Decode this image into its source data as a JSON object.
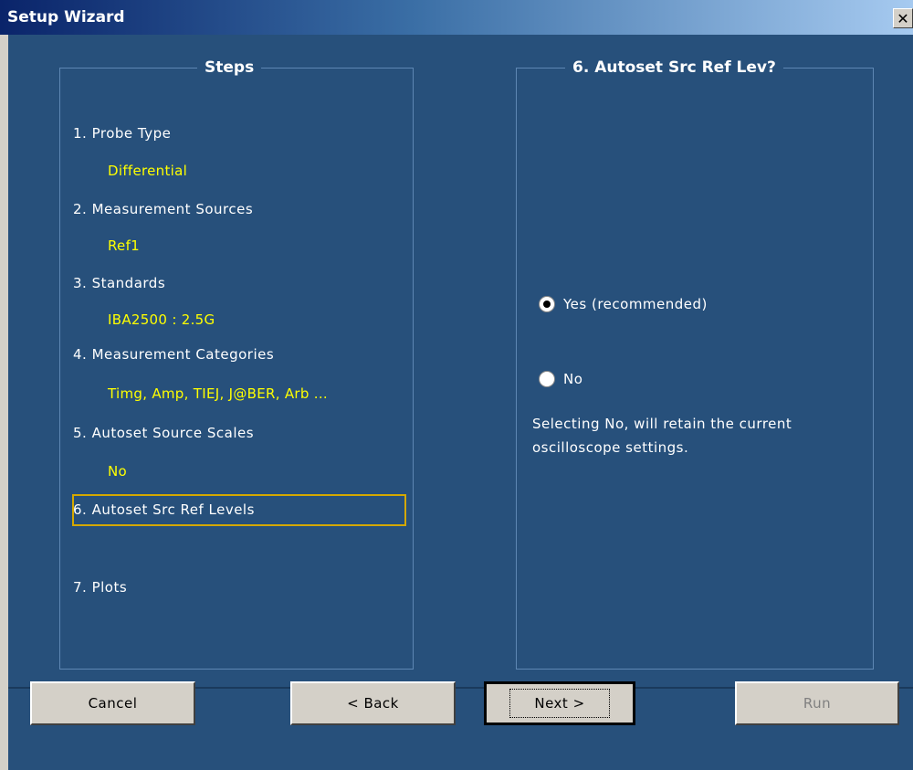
{
  "window": {
    "title": "Setup Wizard",
    "close_glyph": "✕"
  },
  "steps_panel": {
    "title": "Steps",
    "steps": [
      {
        "label": "1. Probe Type",
        "value": "Differential"
      },
      {
        "label": "2. Measurement Sources",
        "value": "Ref1"
      },
      {
        "label": "3. Standards",
        "value": "IBA2500 : 2.5G"
      },
      {
        "label": "4. Measurement Categories",
        "value": "Timg, Amp, TIEJ, J@BER, Arb ..."
      },
      {
        "label": "5. Autoset Source Scales",
        "value": "No"
      },
      {
        "label": "6. Autoset Src Ref Levels",
        "value": ""
      },
      {
        "label": "7. Plots",
        "value": ""
      }
    ],
    "active_step": 6
  },
  "options_panel": {
    "title": "6. Autoset Src Ref Lev?",
    "options": [
      {
        "label": "Yes (recommended)",
        "selected": true
      },
      {
        "label": "No",
        "selected": false
      }
    ],
    "description_line1": "Selecting No, will retain the current",
    "description_line2": "oscilloscope settings."
  },
  "buttons": {
    "cancel": "Cancel",
    "back": "< Back",
    "next": "Next >",
    "run": "Run"
  },
  "colors": {
    "background": "#27507b",
    "value_text": "#ffff00",
    "active_border": "#d4a800"
  }
}
